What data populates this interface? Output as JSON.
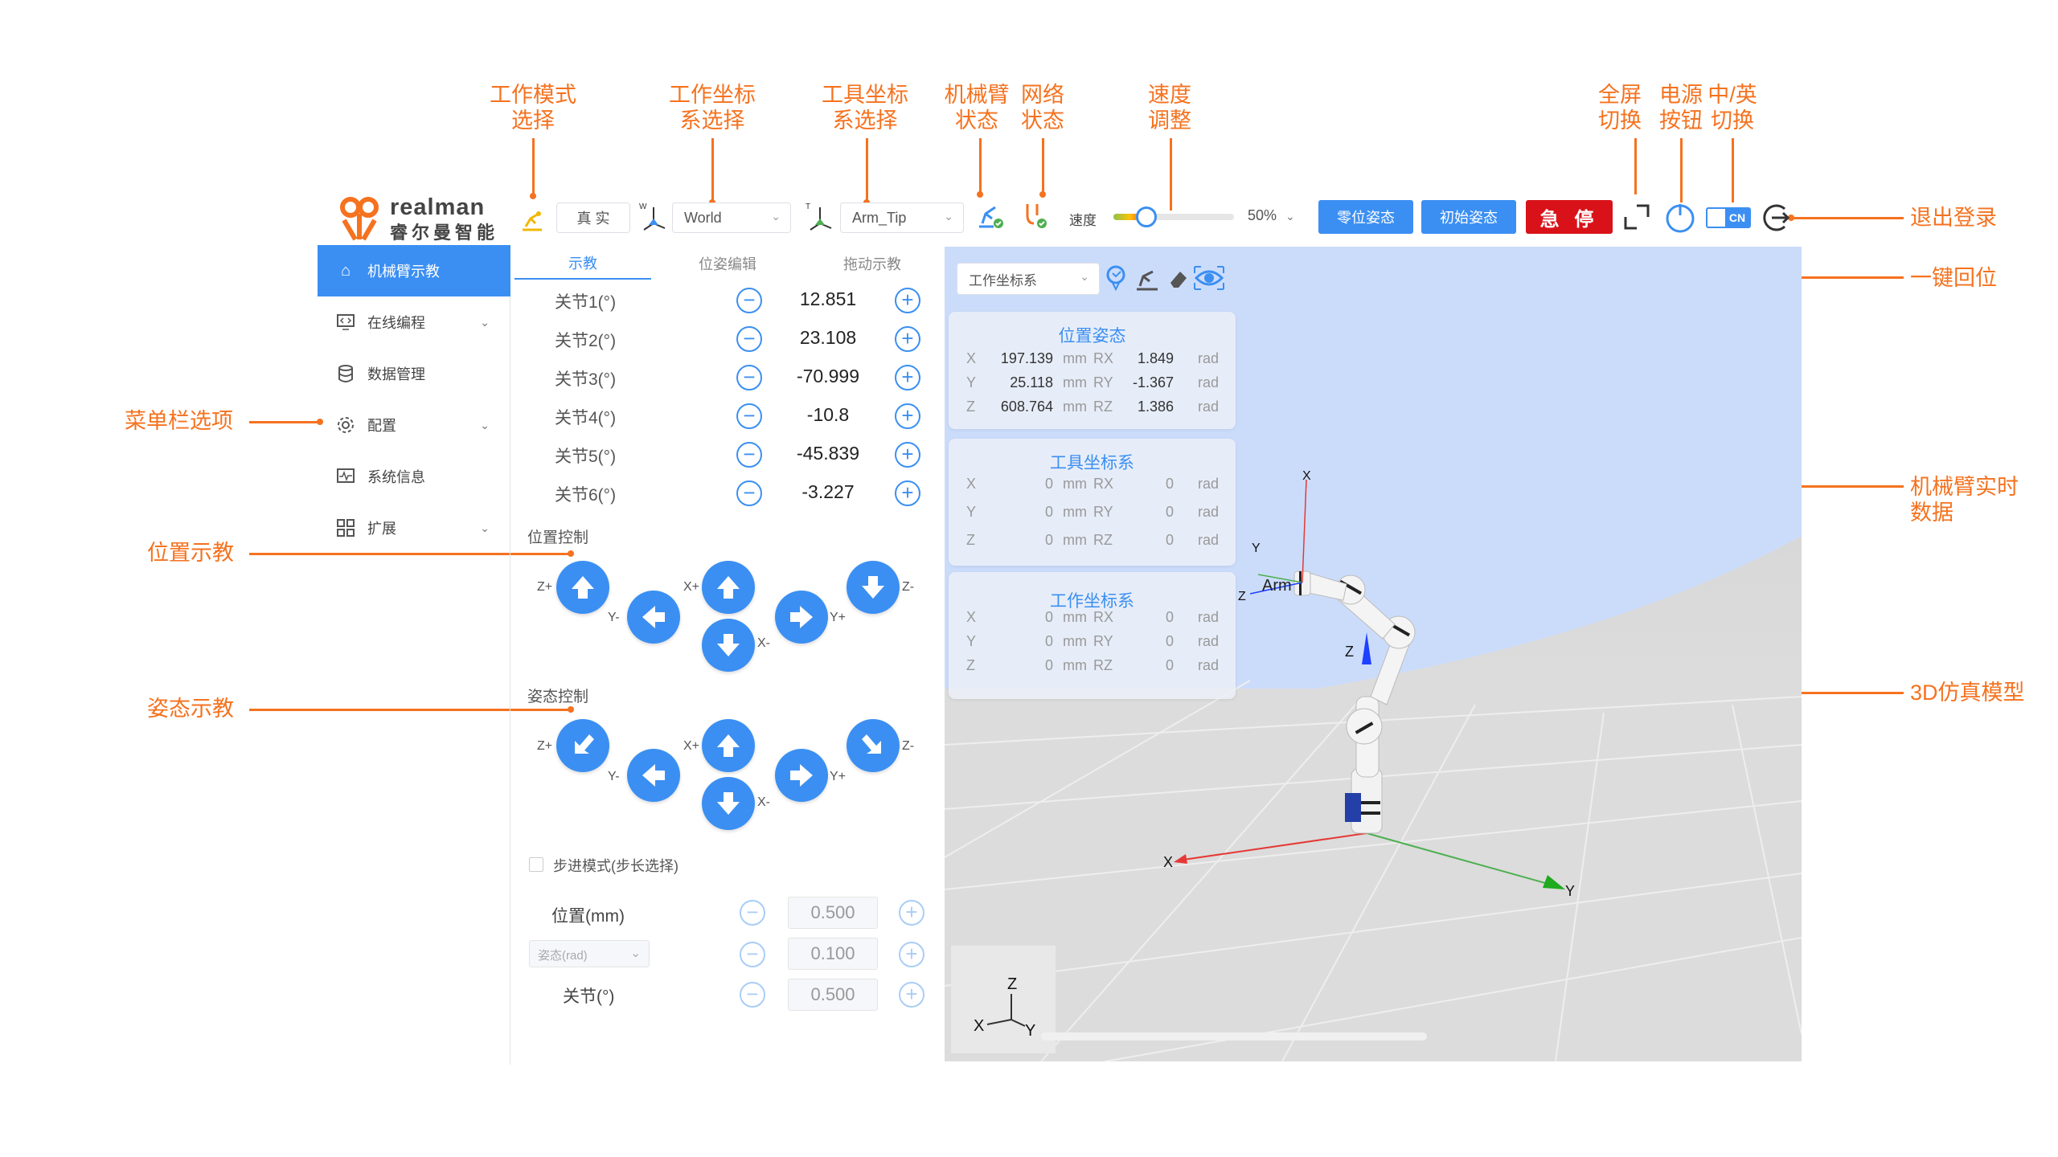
{
  "callouts": {
    "work_mode": "工作模式\n选择",
    "work_frame": "工作坐标\n系选择",
    "tool_frame": "工具坐标\n系选择",
    "arm_status": "机械臂\n状态",
    "net_status": "网络\n状态",
    "speed_adjust": "速度\n调整",
    "fullscreen": "全屏\n切换",
    "power": "电源\n按钮",
    "lang": "中/英\n切换",
    "logout": "退出登录",
    "home": "一键回位",
    "realtime": "机械臂实时\n数据",
    "menu": "菜单栏选项",
    "pos_teach": "位置示教",
    "pose_teach": "姿态示教",
    "model3d": "3D仿真模型"
  },
  "brand": {
    "name": "realman",
    "sub": "睿尔曼智能"
  },
  "topbar": {
    "mode_value": "真 实",
    "work_frame_value": "World",
    "tool_frame_value": "Arm_Tip",
    "speed_label": "速度",
    "speed_value": "50%",
    "speed_fraction": 0.5,
    "zero_pose_btn": "零位姿态",
    "init_pose_btn": "初始姿态",
    "estop_btn": "急 停",
    "lang_badge": "CN",
    "accent": "#3b8ff2",
    "estop_color": "#d9121a"
  },
  "sidebar": {
    "items": [
      {
        "label": "机械臂示教",
        "icon": "home-icon",
        "active": true
      },
      {
        "label": "在线编程",
        "icon": "code-monitor-icon",
        "expand": true
      },
      {
        "label": "数据管理",
        "icon": "database-icon"
      },
      {
        "label": "配置",
        "icon": "gear-icon",
        "expand": true
      },
      {
        "label": "系统信息",
        "icon": "pulse-monitor-icon"
      },
      {
        "label": "扩展",
        "icon": "grid-icon",
        "expand": true
      }
    ]
  },
  "teach": {
    "tabs": [
      "示教",
      "位姿编辑",
      "拖动示教"
    ],
    "joints": [
      {
        "label": "关节1(°)",
        "value": "12.851"
      },
      {
        "label": "关节2(°)",
        "value": "23.108"
      },
      {
        "label": "关节3(°)",
        "value": "-70.999"
      },
      {
        "label": "关节4(°)",
        "value": "-10.8"
      },
      {
        "label": "关节5(°)",
        "value": "-45.839"
      },
      {
        "label": "关节6(°)",
        "value": "-3.227"
      }
    ],
    "pos_title": "位置控制",
    "pose_title": "姿态控制",
    "axis": {
      "zp": "Z+",
      "zm": "Z-",
      "yp": "Y+",
      "ym": "Y-",
      "xp": "X+",
      "xm": "X-"
    },
    "step_mode": "步进模式(步长选择)",
    "step_pos_label": "位置(mm)",
    "step_pos_value": "0.500",
    "step_pose_select": "姿态(rad)",
    "step_pose_value": "0.100",
    "step_joint_label": "关节(°)",
    "step_joint_value": "0.500"
  },
  "view": {
    "frame_select": "工作坐标系",
    "pose_panel": {
      "title": "位置姿态",
      "rows": [
        {
          "a": "X",
          "v1": "197.139",
          "u1": "mm",
          "b": "RX",
          "v2": "1.849",
          "u2": "rad"
        },
        {
          "a": "Y",
          "v1": "25.118",
          "u1": "mm",
          "b": "RY",
          "v2": "-1.367",
          "u2": "rad"
        },
        {
          "a": "Z",
          "v1": "608.764",
          "u1": "mm",
          "b": "RZ",
          "v2": "1.386",
          "u2": "rad"
        }
      ]
    },
    "tool_panel": {
      "title": "工具坐标系",
      "rows": [
        {
          "a": "X",
          "v1": "0",
          "u1": "mm",
          "b": "RX",
          "v2": "0",
          "u2": "rad"
        },
        {
          "a": "Y",
          "v1": "0",
          "u1": "mm",
          "b": "RY",
          "v2": "0",
          "u2": "rad"
        },
        {
          "a": "Z",
          "v1": "0",
          "u1": "mm",
          "b": "RZ",
          "v2": "0",
          "u2": "rad"
        }
      ]
    },
    "work_panel": {
      "title": "工作坐标系",
      "rows": [
        {
          "a": "X",
          "v1": "0",
          "u1": "mm",
          "b": "RX",
          "v2": "0",
          "u2": "rad"
        },
        {
          "a": "Y",
          "v1": "0",
          "u1": "mm",
          "b": "RY",
          "v2": "0",
          "u2": "rad"
        },
        {
          "a": "Z",
          "v1": "0",
          "u1": "mm",
          "b": "RZ",
          "v2": "0",
          "u2": "rad"
        }
      ]
    },
    "axis_labels": {
      "x": "X",
      "y": "Y",
      "z": "Z"
    },
    "arm_label": "Arm"
  }
}
